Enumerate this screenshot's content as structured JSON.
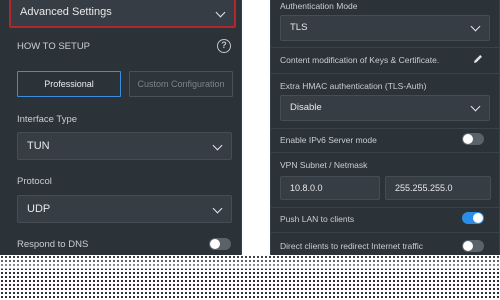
{
  "left": {
    "advanced_settings": "Advanced Settings",
    "how_to_setup": "HOW TO SETUP",
    "help_icon": "help-circle-icon",
    "professional_label": "Professional",
    "custom_label": "Custom Configuration",
    "interface_type_label": "Interface Type",
    "interface_type_value": "TUN",
    "protocol_label": "Protocol",
    "protocol_value": "UDP",
    "respond_dns_label": "Respond to DNS",
    "respond_dns_on": false
  },
  "right": {
    "auth_mode_label": "Authentication Mode",
    "auth_mode_value": "TLS",
    "content_mod_label": "Content modification of Keys & Certificate.",
    "edit_icon": "pencil-icon",
    "hmac_label": "Extra HMAC authentication (TLS-Auth)",
    "hmac_value": "Disable",
    "ipv6_label": "Enable IPv6 Server mode",
    "ipv6_on": false,
    "subnet_label": "VPN Subnet / Netmask",
    "subnet_value": "10.8.0.0",
    "netmask_value": "255.255.255.0",
    "push_lan_label": "Push LAN to clients",
    "push_lan_on": true,
    "direct_clients_label": "Direct clients to redirect Internet traffic",
    "direct_clients_on": false
  },
  "colors": {
    "panel_bg": "#2b3238",
    "accent_blue": "#2a8ee6",
    "highlight_red": "#b3262d"
  }
}
